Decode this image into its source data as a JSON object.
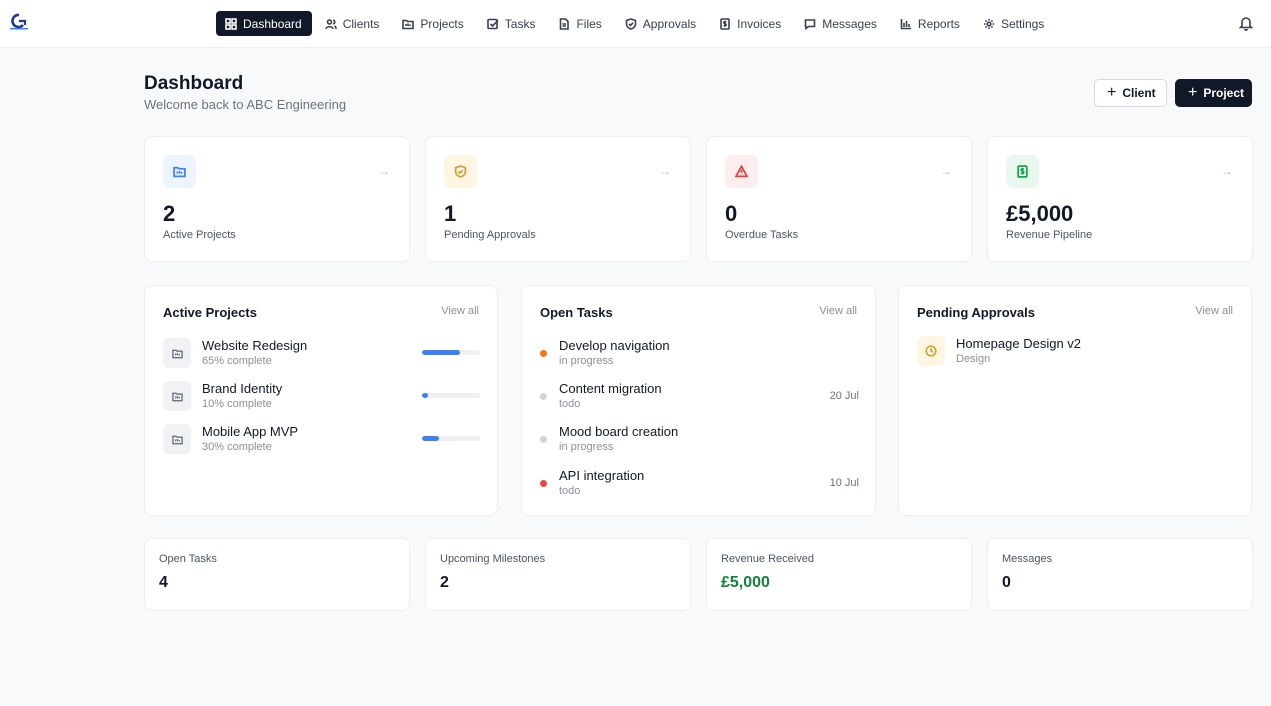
{
  "nav": {
    "items": [
      {
        "label": "Dashboard",
        "icon": "dashboard-icon",
        "active": true
      },
      {
        "label": "Clients",
        "icon": "users-icon"
      },
      {
        "label": "Projects",
        "icon": "folder-icon"
      },
      {
        "label": "Tasks",
        "icon": "checkbox-icon"
      },
      {
        "label": "Files",
        "icon": "file-icon"
      },
      {
        "label": "Approvals",
        "icon": "shield-check-icon"
      },
      {
        "label": "Invoices",
        "icon": "invoice-icon"
      },
      {
        "label": "Messages",
        "icon": "message-icon"
      },
      {
        "label": "Reports",
        "icon": "bar-chart-icon"
      },
      {
        "label": "Settings",
        "icon": "gear-icon"
      }
    ]
  },
  "header": {
    "title": "Dashboard",
    "subtitle": "Welcome back to ABC Engineering",
    "client_button": "Client",
    "project_button": "Project"
  },
  "stats": [
    {
      "value": "2",
      "label": "Active Projects",
      "icon": "folder-icon",
      "color": "#3b82f6",
      "bg": "#eef4fe"
    },
    {
      "value": "1",
      "label": "Pending Approvals",
      "icon": "shield-check-icon",
      "color": "#d69e2e",
      "bg": "#fdf6e3"
    },
    {
      "value": "0",
      "label": "Overdue Tasks",
      "icon": "warning-icon",
      "color": "#e53e3e",
      "bg": "#fdeeee"
    },
    {
      "value": "£5,000",
      "label": "Revenue Pipeline",
      "icon": "invoice-icon",
      "color": "#16a34a",
      "bg": "#e9f8ef"
    }
  ],
  "active_projects": {
    "title": "Active Projects",
    "view_all": "View all",
    "items": [
      {
        "name": "Website Redesign",
        "sub": "65% complete",
        "progress": 65
      },
      {
        "name": "Brand Identity",
        "sub": "10% complete",
        "progress": 10
      },
      {
        "name": "Mobile App MVP",
        "sub": "30% complete",
        "progress": 30
      }
    ]
  },
  "open_tasks": {
    "title": "Open Tasks",
    "view_all": "View all",
    "items": [
      {
        "name": "Develop navigation",
        "status": "in progress",
        "date": "",
        "dot": "#f97316"
      },
      {
        "name": "Content migration",
        "status": "todo",
        "date": "20 Jul",
        "dot": "#d1d5db"
      },
      {
        "name": "Mood board creation",
        "status": "in progress",
        "date": "",
        "dot": "#d1d5db"
      },
      {
        "name": "API integration",
        "status": "todo",
        "date": "10 Jul",
        "dot": "#ef4444"
      }
    ]
  },
  "pending_approvals": {
    "title": "Pending Approvals",
    "view_all": "View all",
    "items": [
      {
        "name": "Homepage Design v2",
        "type": "Design",
        "icon": "clock-icon"
      }
    ]
  },
  "summary": [
    {
      "label": "Open Tasks",
      "value": "4",
      "color": "#111827"
    },
    {
      "label": "Upcoming Milestones",
      "value": "2",
      "color": "#111827"
    },
    {
      "label": "Revenue Received",
      "value": "£5,000",
      "color": "#15803d"
    },
    {
      "label": "Messages",
      "value": "0",
      "color": "#111827"
    }
  ],
  "colors": {
    "primary": "#111827",
    "accent": "#3b82f6",
    "background": "#f8f9fb"
  }
}
